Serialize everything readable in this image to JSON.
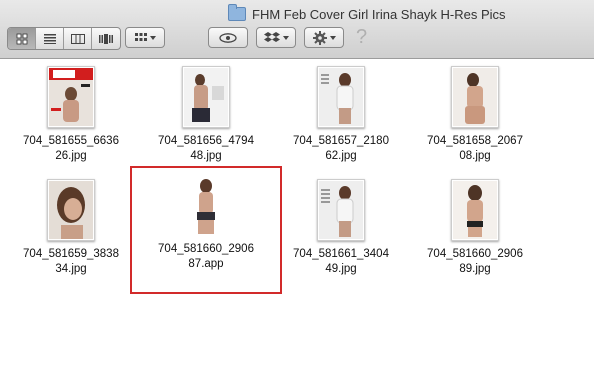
{
  "window": {
    "title": "FHM Feb Cover Girl Irina Shayk H-Res Pics"
  },
  "toolbar": {
    "view_modes": [
      "icon-view",
      "list-view",
      "column-view",
      "cover-flow-view"
    ],
    "active_view": "icon-view"
  },
  "files": [
    {
      "line1": "704_581655_6636",
      "line2": "26.jpg"
    },
    {
      "line1": "704_581656_4794",
      "line2": "48.jpg"
    },
    {
      "line1": "704_581657_2180",
      "line2": "62.jpg"
    },
    {
      "line1": "704_581658_2067",
      "line2": "08.jpg"
    },
    {
      "line1": "704_581659_3838",
      "line2": "34.jpg"
    },
    {
      "line1": "704_581660_2906",
      "line2": "87.app"
    },
    {
      "line1": "704_581661_3404",
      "line2": "49.jpg"
    },
    {
      "line1": "704_581660_2906",
      "line2": "89.jpg"
    }
  ],
  "colors": {
    "highlight": "#d22a2a"
  }
}
